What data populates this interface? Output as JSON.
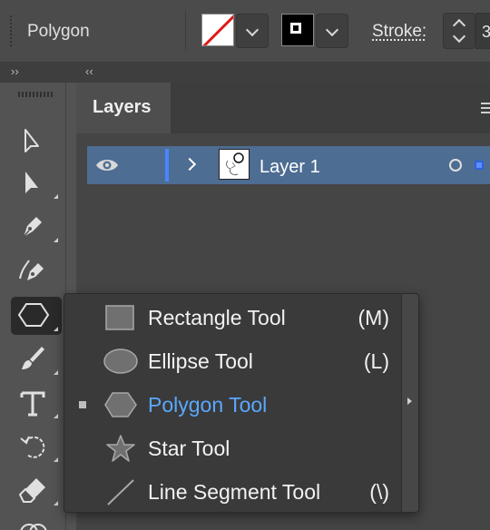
{
  "control_bar": {
    "tool_name": "Polygon",
    "stroke_label": "Stroke:",
    "stroke_value": "3"
  },
  "collapse_strip": {
    "left_toggle": "››",
    "right_toggle": "‹‹"
  },
  "tools": [
    {
      "icon": "selection-arrow-icon"
    },
    {
      "icon": "direct-selection-arrow-icon"
    },
    {
      "icon": "pen-icon"
    },
    {
      "icon": "curvature-pen-icon"
    },
    {
      "icon": "polygon-icon",
      "active": true
    },
    {
      "icon": "paintbrush-icon"
    },
    {
      "icon": "type-icon",
      "label": "T"
    },
    {
      "icon": "rotate-icon"
    },
    {
      "icon": "eraser-icon"
    }
  ],
  "layers_panel": {
    "tab_label": "Layers",
    "layers": [
      {
        "name": "Layer 1",
        "visible": true,
        "color": "#4a86ff"
      }
    ]
  },
  "flyout": {
    "items": [
      {
        "icon": "rectangle-icon",
        "label": "Rectangle Tool",
        "shortcut": "(M)"
      },
      {
        "icon": "ellipse-icon",
        "label": "Ellipse Tool",
        "shortcut": "(L)"
      },
      {
        "icon": "polygon-icon",
        "label": "Polygon Tool",
        "shortcut": "",
        "current": true
      },
      {
        "icon": "star-icon",
        "label": "Star Tool",
        "shortcut": ""
      },
      {
        "icon": "line-segment-icon",
        "label": "Line Segment Tool",
        "shortcut": "(\\)"
      }
    ]
  },
  "colors": {
    "current_item": "#5aa8ff",
    "layer_row_bg": "#4d6d92",
    "fill_none_slash": "#e01a1a"
  }
}
